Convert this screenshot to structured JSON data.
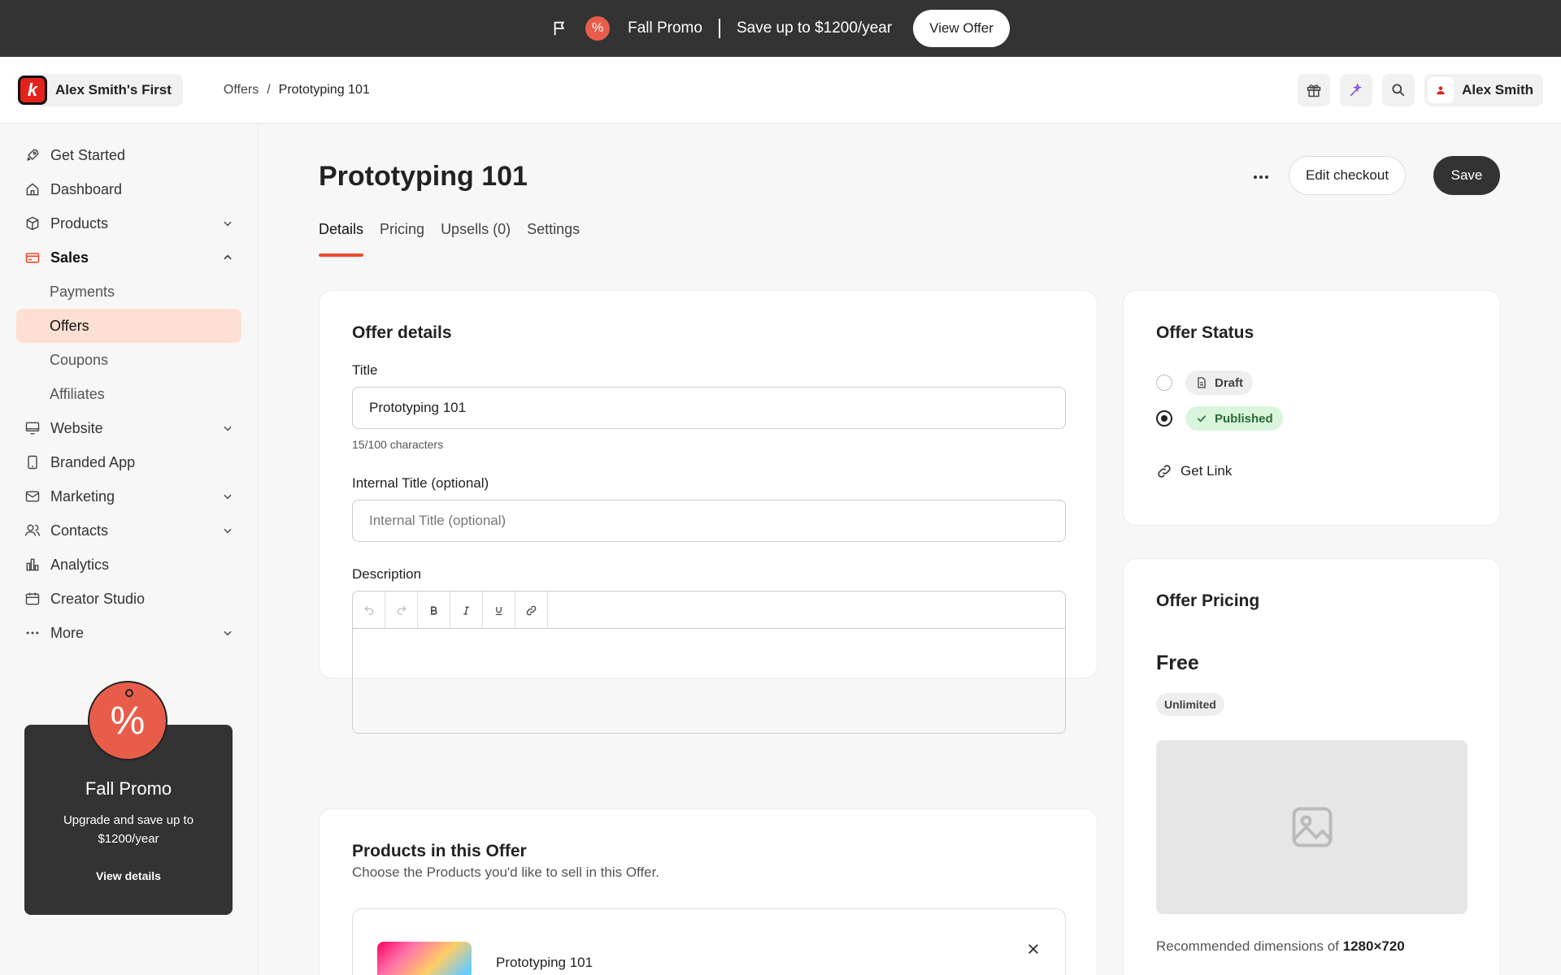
{
  "promo_bar": {
    "title": "Fall Promo",
    "message": "Save up to $1200/year",
    "cta": "View Offer",
    "badge": "%"
  },
  "header": {
    "workspace_name": "Alex Smith's First",
    "logo_letter": "k",
    "breadcrumb": [
      "Offers",
      "/",
      "Prototyping 101"
    ],
    "user_name": "Alex Smith"
  },
  "sidebar": {
    "items": [
      {
        "label": "Get Started",
        "icon": "rocket-icon"
      },
      {
        "label": "Dashboard",
        "icon": "home-icon"
      },
      {
        "label": "Products",
        "icon": "box-icon"
      },
      {
        "label": "Sales",
        "icon": "card-icon"
      },
      {
        "label": "Payments"
      },
      {
        "label": "Offers"
      },
      {
        "label": "Coupons"
      },
      {
        "label": "Affiliates"
      },
      {
        "label": "Website",
        "icon": "monitor-icon"
      },
      {
        "label": "Branded App",
        "icon": "phone-icon"
      },
      {
        "label": "Marketing",
        "icon": "mail-icon"
      },
      {
        "label": "Contacts",
        "icon": "people-icon"
      },
      {
        "label": "Analytics",
        "icon": "chart-icon"
      },
      {
        "label": "Creator Studio",
        "icon": "calendar-icon"
      },
      {
        "label": "More",
        "icon": "dots-icon"
      }
    ],
    "promo_card": {
      "title": "Fall Promo",
      "description": "Upgrade and save up to $1200/year",
      "link": "View details",
      "badge": "%"
    }
  },
  "main": {
    "title": "Prototyping 101",
    "edit_checkout": "Edit checkout",
    "save": "Save",
    "tabs": [
      "Details",
      "Pricing",
      "Upsells (0)",
      "Settings"
    ],
    "offer_details": {
      "heading": "Offer details",
      "title_label": "Title",
      "title_value": "Prototyping 101",
      "char_count": "15/100 characters",
      "internal_label": "Internal Title (optional)",
      "internal_placeholder": "Internal Title (optional)",
      "description_label": "Description"
    },
    "offer_status": {
      "heading": "Offer Status",
      "draft": "Draft",
      "published": "Published",
      "selected": "Published",
      "get_link": "Get Link"
    },
    "offer_pricing": {
      "heading": "Offer Pricing",
      "price": "Free",
      "badge": "Unlimited",
      "dims_prefix": "Recommended dimensions of",
      "dims_value": "1280×720"
    },
    "products": {
      "heading": "Products in this Offer",
      "subtitle": "Choose the Products you'd like to sell in this Offer.",
      "items": [
        {
          "name": "Prototyping 101"
        }
      ]
    }
  },
  "colors": {
    "accent": "#ef4b2b",
    "active_nav_bg": "#fde0d3",
    "promo_bg": "#333333",
    "published_bg": "#d9f5dc"
  }
}
